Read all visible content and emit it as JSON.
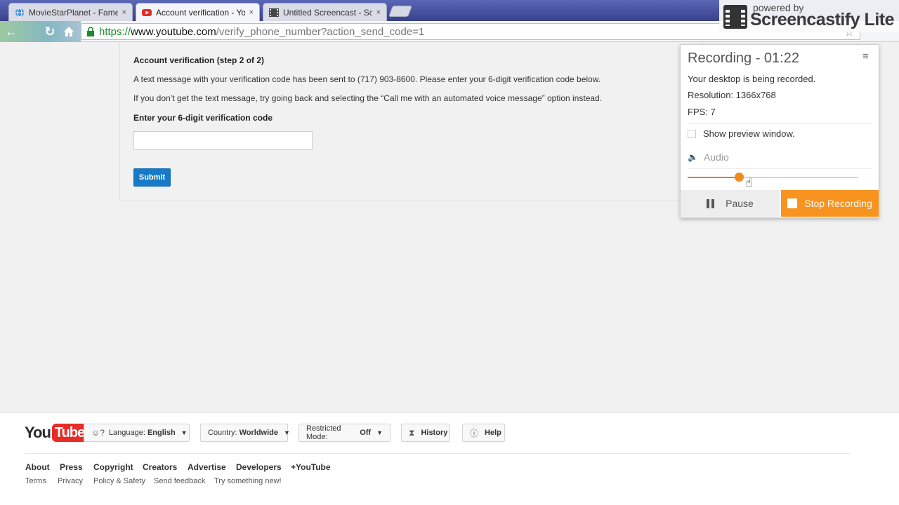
{
  "browser": {
    "tabs": [
      {
        "title": "MovieStarPlanet - Fame",
        "close": "×"
      },
      {
        "title": "Account verification - Yo",
        "close": "×"
      },
      {
        "title": "Untitled Screencast - Sc",
        "close": "×"
      }
    ],
    "url": {
      "scheme": "https://",
      "host": "www.youtube.com",
      "path": "/verify_phone_number?action_send_code=1"
    }
  },
  "verification": {
    "title": "Account verification (step 2 of 2)",
    "sent_message": "A text message with your verification code has been sent to (717) 903-8600. Please enter your 6-digit verification code below.",
    "fallback_message": "If you don’t get the text message, try going back and selecting the “Call me with an automated voice message” option instead.",
    "code_label": "Enter your 6-digit verification code",
    "code_value": "",
    "submit_label": "Submit"
  },
  "footer": {
    "logo_you": "You",
    "logo_tube": "Tube",
    "language_prefix": "Language:",
    "language_value": "English",
    "country_prefix": "Country:",
    "country_value": "Worldwide",
    "restricted_prefix": "Restricted Mode:",
    "restricted_value": "Off",
    "history_label": "History",
    "help_label": "Help",
    "links": [
      "About",
      "Press",
      "Copyright",
      "Creators",
      "Advertise",
      "Developers",
      "+YouTube"
    ],
    "sublinks": [
      "Terms",
      "Privacy",
      "Policy & Safety",
      "Send feedback",
      "Try something new!"
    ]
  },
  "screencastify": {
    "powered_by": "powered by",
    "brand": "Screencastify Lite",
    "recording_title": "Recording - 01:22",
    "status": "Your desktop is being recorded.",
    "resolution": "Resolution: 1366x768",
    "fps": "FPS: 7",
    "preview_label": "Show preview window.",
    "preview_checked": false,
    "audio_label": "Audio",
    "audio_level": 0.3,
    "pause_label": "Pause",
    "stop_label": "Stop Recording",
    "accent_color": "#f7931e"
  }
}
